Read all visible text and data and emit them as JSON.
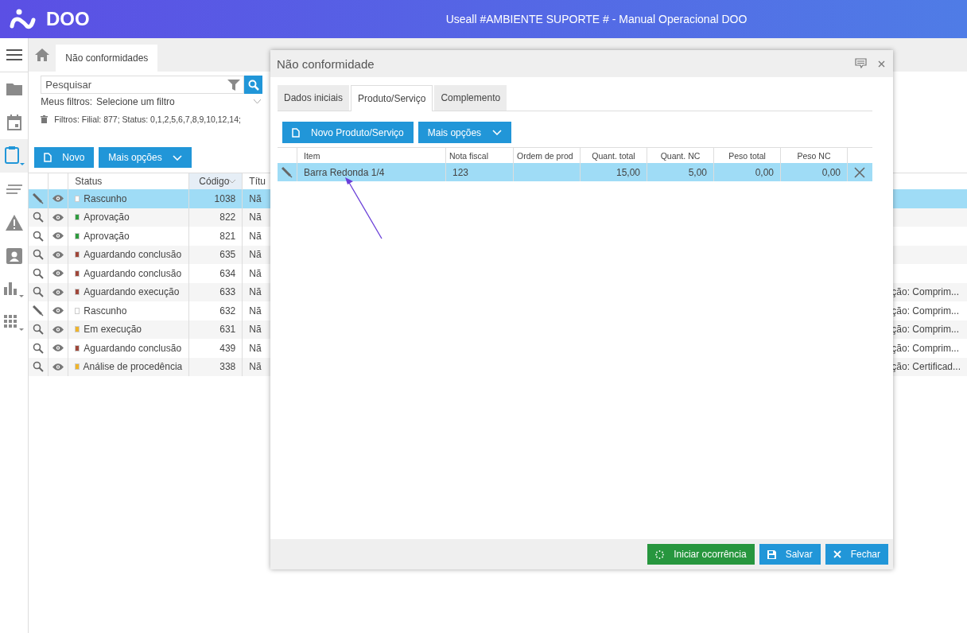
{
  "app": {
    "logo": "DOO",
    "title": "Useall #AMBIENTE SUPORTE # - Manual Operacional DOO"
  },
  "sidebar": [
    {
      "kind": "menu",
      "selected": false
    },
    {
      "kind": "folder",
      "selected": false
    },
    {
      "kind": "calendar",
      "selected": false
    },
    {
      "kind": "clipboard",
      "selected": true
    },
    {
      "kind": "lines",
      "selected": false
    },
    {
      "kind": "warning",
      "selected": false
    },
    {
      "kind": "contact",
      "selected": false
    },
    {
      "kind": "chart",
      "selected": false
    },
    {
      "kind": "grid",
      "selected": false
    }
  ],
  "tabs": [
    {
      "label": "Não conformidades",
      "selected": true
    }
  ],
  "search": {
    "placeholder": "Pesquisar"
  },
  "filters": {
    "label": "Meus filtros:",
    "value": "Selecione um filtro",
    "applied": "Filtros: Filial: 877; Status: 0,1,2,5,6,7,8,9,10,12,14;"
  },
  "toolbar": [
    {
      "label": "Novo",
      "kind": "new"
    },
    {
      "label": "Mais opções",
      "kind": "menu"
    }
  ],
  "table": {
    "columns": [
      {
        "label": "Status",
        "sorted": false
      },
      {
        "label": "Código",
        "sorted": true
      },
      {
        "label": "Títu",
        "sorted": false
      }
    ],
    "rows": [
      {
        "kind": "edit",
        "color": "#ffffff",
        "status": "Rascunho",
        "code": "1038",
        "title": "Nã",
        "selected": true
      },
      {
        "kind": "view",
        "color": "#2e9b3e",
        "status": "Aprovação",
        "code": "822",
        "title": "Nã",
        "selected": false
      },
      {
        "kind": "view",
        "color": "#2e9b3e",
        "status": "Aprovação",
        "code": "821",
        "title": "Nã",
        "selected": false
      },
      {
        "kind": "view",
        "color": "#a0473a",
        "status": "Aguardando conclusão",
        "code": "635",
        "title": "Nã",
        "selected": false
      },
      {
        "kind": "view",
        "color": "#a0473a",
        "status": "Aguardando conclusão",
        "code": "634",
        "title": "Nã",
        "selected": false
      },
      {
        "kind": "view",
        "color": "#a0473a",
        "status": "Aguardando execução",
        "code": "633",
        "title": "Nã",
        "column_5": "ção: Comprim...",
        "selected": false
      },
      {
        "kind": "edit",
        "color": "#ffffff",
        "status": "Rascunho",
        "code": "632",
        "title": "Nã",
        "column_5": "ção: Comprim...",
        "selected": false
      },
      {
        "kind": "view",
        "color": "#f0b429",
        "status": "Em execução",
        "code": "631",
        "title": "Nã",
        "column_5": "ção: Comprim...",
        "selected": false
      },
      {
        "kind": "view",
        "color": "#a0473a",
        "status": "Aguardando conclusão",
        "code": "439",
        "title": "Nã",
        "column_5": "ção: Comprim...",
        "selected": false
      },
      {
        "kind": "view",
        "color": "#f0b429",
        "status": "Análise de procedência",
        "code": "338",
        "title": "Nã",
        "column_5": "ção: Certificad...",
        "selected": false
      }
    ]
  },
  "dialog": {
    "title": "Não conformidade",
    "tabs": [
      {
        "label": "Dados iniciais",
        "selected": false
      },
      {
        "label": "Produto/Serviço",
        "selected": true
      },
      {
        "label": "Complemento",
        "selected": false
      }
    ],
    "toolbar": [
      {
        "label": "Novo Produto/Serviço",
        "kind": "new"
      },
      {
        "label": "Mais opções",
        "kind": "menu"
      }
    ],
    "grid": {
      "columns": [
        "Item",
        "Nota fiscal",
        "Ordem de prod",
        "Quant. total",
        "Quant. NC",
        "Peso total",
        "Peso NC"
      ],
      "rows": [
        {
          "cells": [
            "Barra Redonda 1/4",
            "123",
            null,
            "15,00",
            "5,00",
            "0,00",
            "0,00"
          ],
          "selected": true
        }
      ]
    },
    "footer": [
      {
        "label": "Iniciar ocorrência",
        "kind": "start"
      },
      {
        "label": "Salvar",
        "kind": "save"
      },
      {
        "label": "Fechar",
        "kind": "close"
      }
    ]
  }
}
